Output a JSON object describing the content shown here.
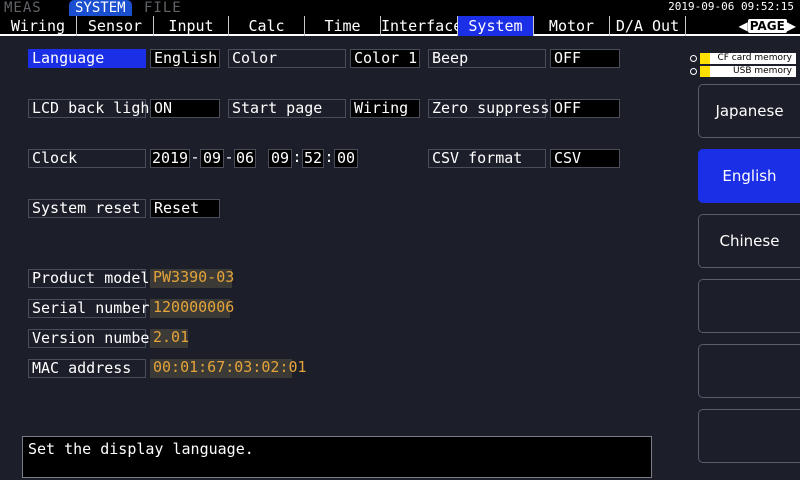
{
  "mode_tabs": [
    {
      "label": "MEAS",
      "active": false
    },
    {
      "label": "SYSTEM",
      "active": true
    },
    {
      "label": "FILE",
      "active": false
    }
  ],
  "datetime": "2019-09-06 09:52:15",
  "tabs": [
    {
      "label": "Wiring"
    },
    {
      "label": "Sensor"
    },
    {
      "label": "Input"
    },
    {
      "label": "Calc"
    },
    {
      "label": "Time"
    },
    {
      "label": "Interface"
    },
    {
      "label": "System",
      "selected": true
    },
    {
      "label": "Motor"
    },
    {
      "label": "D/A Out"
    }
  ],
  "page_key": "PAGE",
  "settings": {
    "language": {
      "label": "Language",
      "value": "English"
    },
    "color": {
      "label": "Color",
      "value": "Color 1"
    },
    "beep": {
      "label": "Beep",
      "value": "OFF"
    },
    "lcd": {
      "label": "LCD back light",
      "value": "ON"
    },
    "start_page": {
      "label": "Start page",
      "value": "Wiring"
    },
    "zero_suppress": {
      "label": "Zero suppress",
      "value": "OFF"
    },
    "clock": {
      "label": "Clock",
      "year": "2019",
      "month": "09",
      "day": "06",
      "hour": "09",
      "minute": "52",
      "second": "00",
      "date_sep": "-",
      "time_sep": ":"
    },
    "csv_format": {
      "label": "CSV format",
      "value": "CSV"
    },
    "system_reset": {
      "label": "System reset",
      "value": "Reset"
    }
  },
  "info": {
    "product_model": {
      "label": "Product model",
      "value": "PW3390-03"
    },
    "serial_number": {
      "label": "Serial number",
      "value": "120000006"
    },
    "version_number": {
      "label": "Version number",
      "value": "2.01"
    },
    "mac_address": {
      "label": "MAC address",
      "value": "00:01:67:03:02:01"
    }
  },
  "help_text": "Set the display language.",
  "media": {
    "cf": "CF card memory",
    "usb": "USB  memory"
  },
  "function_keys": [
    {
      "label": "Japanese",
      "active": false
    },
    {
      "label": "English",
      "active": true
    },
    {
      "label": "Chinese",
      "active": false
    },
    {
      "label": "",
      "active": false
    },
    {
      "label": "",
      "active": false
    },
    {
      "label": "",
      "active": false
    }
  ],
  "colors": {
    "background": "#1c1e2a",
    "selection_blue": "#1a2fe6",
    "info_value_orange": "#e4a43a",
    "info_value_bg": "#3b3a36"
  }
}
